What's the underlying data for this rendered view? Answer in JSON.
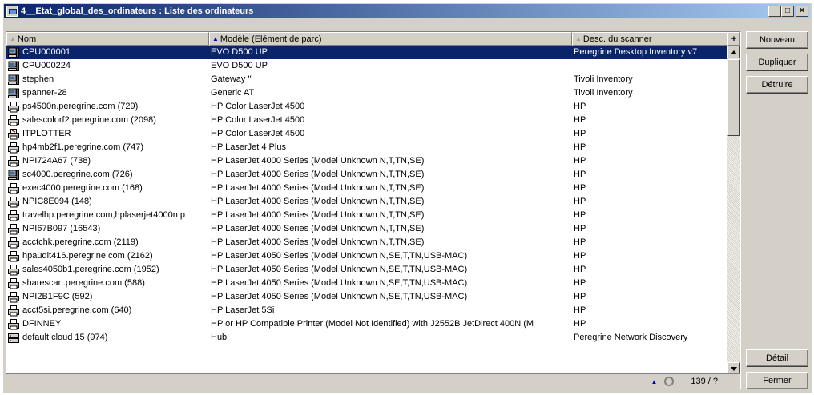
{
  "window": {
    "title": "4__Etat_global_des_ordinateurs : Liste des ordinateurs",
    "minimize_label": "_",
    "maximize_label": "□",
    "close_label": "×"
  },
  "columns": [
    {
      "label": "Nom",
      "sort": "none"
    },
    {
      "label": "Modèle (Elément de parc)",
      "sort": "ascending"
    },
    {
      "label": "Desc. du scanner",
      "sort": "none"
    }
  ],
  "add_column_label": "+",
  "rows": [
    {
      "icon": "computer-icon",
      "name": "CPU000001",
      "model": "EVO D500 UP",
      "scanner": "Peregrine Desktop Inventory v7",
      "selected": true
    },
    {
      "icon": "computer-icon",
      "name": "CPU000224",
      "model": "EVO D500 UP",
      "scanner": ""
    },
    {
      "icon": "computer-icon",
      "name": "stephen",
      "model": "Gateway ''",
      "scanner": "Tivoli Inventory"
    },
    {
      "icon": "computer-icon",
      "name": "spanner-28",
      "model": "Generic AT",
      "scanner": "Tivoli Inventory"
    },
    {
      "icon": "printer-icon",
      "name": "ps4500n.peregrine.com (729)",
      "model": "HP Color LaserJet 4500",
      "scanner": "HP"
    },
    {
      "icon": "printer-icon",
      "name": "salescolorf2.peregrine.com (2098)",
      "model": "HP Color LaserJet 4500",
      "scanner": "HP"
    },
    {
      "icon": "plotter-icon",
      "name": "ITPLOTTER",
      "model": "HP Color LaserJet 4500",
      "scanner": "HP"
    },
    {
      "icon": "printer-icon",
      "name": "hp4mb2f1.peregrine.com (747)",
      "model": "HP LaserJet 4 Plus",
      "scanner": "HP"
    },
    {
      "icon": "printer-icon",
      "name": "NPI724A67 (738)",
      "model": "HP LaserJet 4000 Series (Model Unknown N,T,TN,SE)",
      "scanner": "HP"
    },
    {
      "icon": "computer-icon",
      "name": "sc4000.peregrine.com (726)",
      "model": "HP LaserJet 4000 Series (Model Unknown N,T,TN,SE)",
      "scanner": "HP"
    },
    {
      "icon": "printer-icon",
      "name": "exec4000.peregrine.com (168)",
      "model": "HP LaserJet 4000 Series (Model Unknown N,T,TN,SE)",
      "scanner": "HP"
    },
    {
      "icon": "printer-icon",
      "name": "NPIC8E094 (148)",
      "model": "HP LaserJet 4000 Series (Model Unknown N,T,TN,SE)",
      "scanner": "HP"
    },
    {
      "icon": "printer-icon",
      "name": "travelhp.peregrine.com,hplaserjet4000n.p",
      "model": "HP LaserJet 4000 Series (Model Unknown N,T,TN,SE)",
      "scanner": "HP"
    },
    {
      "icon": "printer-icon",
      "name": "NPI67B097 (16543)",
      "model": "HP LaserJet 4000 Series (Model Unknown N,T,TN,SE)",
      "scanner": "HP"
    },
    {
      "icon": "printer-icon",
      "name": "acctchk.peregrine.com (2119)",
      "model": "HP LaserJet 4000 Series (Model Unknown N,T,TN,SE)",
      "scanner": "HP"
    },
    {
      "icon": "printer-icon",
      "name": "hpaudit416.peregrine.com (2162)",
      "model": "HP LaserJet 4050 Series (Model Unknown N,SE,T,TN,USB-MAC)",
      "scanner": "HP"
    },
    {
      "icon": "printer-icon",
      "name": "sales4050b1.peregrine.com (1952)",
      "model": "HP LaserJet 4050 Series (Model Unknown N,SE,T,TN,USB-MAC)",
      "scanner": "HP"
    },
    {
      "icon": "printer-icon",
      "name": "sharescan.peregrine.com (588)",
      "model": "HP LaserJet 4050 Series (Model Unknown N,SE,T,TN,USB-MAC)",
      "scanner": "HP"
    },
    {
      "icon": "printer-icon",
      "name": "NPI2B1F9C (592)",
      "model": "HP LaserJet 4050 Series (Model Unknown N,SE,T,TN,USB-MAC)",
      "scanner": "HP"
    },
    {
      "icon": "printer-icon",
      "name": "acct5si.peregrine.com (640)",
      "model": "HP LaserJet 5Si",
      "scanner": "HP"
    },
    {
      "icon": "printer-icon",
      "name": "DFINNEY",
      "model": "HP or HP Compatible Printer (Model Not Identified) with J2552B JetDirect 400N (M",
      "scanner": "HP"
    },
    {
      "icon": "hub-icon",
      "name": "default cloud 15 (974)",
      "model": "Hub",
      "scanner": "Peregrine Network Discovery"
    }
  ],
  "status": {
    "count": "139 / ?"
  },
  "buttons": {
    "new": "Nouveau",
    "duplicate": "Dupliquer",
    "destroy": "Détruire",
    "detail": "Détail",
    "close": "Fermer"
  }
}
